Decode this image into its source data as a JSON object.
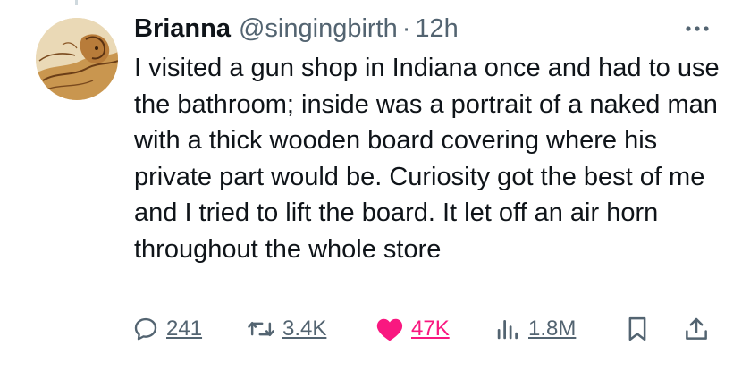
{
  "tweet": {
    "author": {
      "display_name": "Brianna",
      "handle": "@singingbirth",
      "avatar_icon": "sketch-portrait-avatar"
    },
    "separator": "·",
    "timestamp": "12h",
    "text": "I visited a gun shop in Indiana once and had to use the bathroom; inside was a portrait of a naked man with a thick wooden board covering where his private part would be. Curiosity got the best of me and I tried to lift the board. It let off an air horn throughout the whole store",
    "more_icon": "more-options-icon"
  },
  "actions": {
    "reply": {
      "icon": "reply-bubble-icon",
      "count": "241"
    },
    "retweet": {
      "icon": "retweet-icon",
      "count": "3.4K"
    },
    "like": {
      "icon": "heart-filled-icon",
      "count": "47K",
      "color": "#f91880"
    },
    "views": {
      "icon": "views-bar-chart-icon",
      "count": "1.8M"
    },
    "bookmark": {
      "icon": "bookmark-icon"
    },
    "share": {
      "icon": "share-upload-icon"
    }
  },
  "colors": {
    "text_primary": "#0f1419",
    "text_secondary": "#536471",
    "like_pink": "#f91880",
    "divider": "#eff3f4"
  }
}
